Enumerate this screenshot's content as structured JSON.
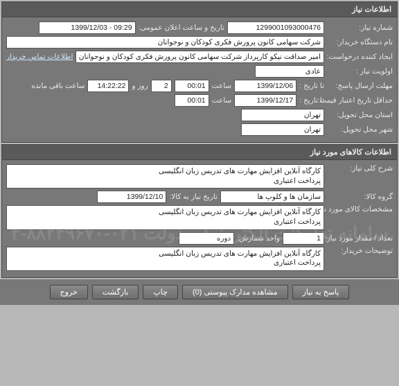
{
  "panel1": {
    "title": "اطلاعات نیاز",
    "need_number_label": "شماره نیاز:",
    "need_number": "1299001093000476",
    "announce_label": "تاریخ و ساعت اعلان عمومی:",
    "announce_value": "09:29 - 1399/12/03",
    "buyer_label": "نام دستگاه خریدار:",
    "buyer_value": "شرکت سهامی کانون پرورش فکری کودکان و نوجوانان",
    "creator_label": "ایجاد کننده درخواست:",
    "creator_value": "امیر صداقت نیکو کارپرداز شرکت سهامی کانون پرورش فکری کودکان و نوجوانان",
    "contact_link": "اطلاعات تماس خریدار",
    "priority_label": "اولویت نیاز :",
    "priority_value": "عادی",
    "deadline_label": "مهلت ارسال پاسخ:",
    "until_label": "تا تاریخ :",
    "until_date": "1399/12/06",
    "time_label": "ساعت",
    "until_time": "00:01",
    "days_value": "2",
    "days_label": "روز و",
    "hours_value": "14:22:22",
    "hours_label": "ساعت باقی مانده",
    "min_credit_label": "حداقل تاریخ اعتبار قیمت:",
    "min_credit_until": "تا تاریخ :",
    "min_credit_date": "1399/12/17",
    "min_credit_time": "00:01",
    "province_label": "استان محل تحویل:",
    "province_value": "تهران",
    "city_label": "شهر محل تحویل:",
    "city_value": "تهران"
  },
  "panel2": {
    "title": "اطلاعات کالاهای مورد نیاز",
    "desc_label": "شرح کلی نیاز:",
    "desc_value": "کارگاه آنلاین افزایش مهارت های تدریس زبان انگلیسی\nپرداخت اعتباری",
    "group_label": "گروه کالا:",
    "group_value": "سازمان ها و کلوپ ها",
    "need_date_label": "تاریخ نیاز به کالا:",
    "need_date_value": "1399/12/10",
    "spec_label": "مشخصات کالای مورد نیاز:",
    "spec_value": "کارگاه آنلاین افزایش مهارت های تدریس زبان انگلیسی\nپرداخت اعتباری",
    "qty_label": "تعداد / مقدار مورد نیاز:",
    "qty_value": "1",
    "unit_label": "واحد شمارش:",
    "unit_value": "دوره",
    "buyer_notes_label": "توضیحات خریدار:",
    "buyer_notes_value": "کارگاه آنلاین افزایش مهارت های تدریس زبان انگلیسی\nپرداخت اعتباری",
    "watermark": "سامانه تدارکات الکترونیکی دولت\n۰۲۱-۸۸۲۴۹۶۷۰-۴"
  },
  "footer": {
    "reply": "پاسخ به نیاز",
    "attachments": "مشاهده مدارک پیوستی (0)",
    "print": "چاپ",
    "back": "بازگشت",
    "exit": "خروج"
  }
}
